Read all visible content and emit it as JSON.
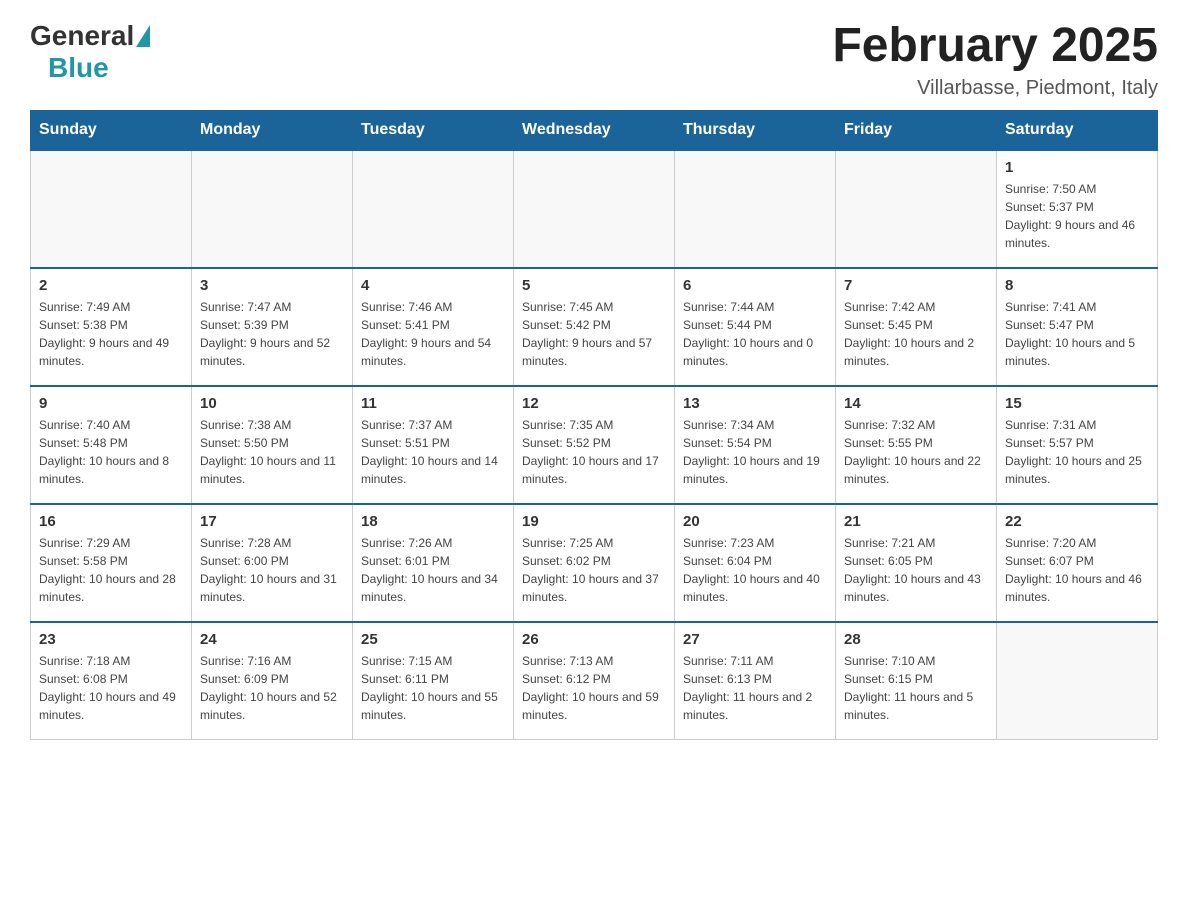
{
  "logo": {
    "general": "General",
    "blue": "Blue"
  },
  "title": "February 2025",
  "subtitle": "Villarbasse, Piedmont, Italy",
  "days_of_week": [
    "Sunday",
    "Monday",
    "Tuesday",
    "Wednesday",
    "Thursday",
    "Friday",
    "Saturday"
  ],
  "weeks": [
    {
      "days": [
        {
          "number": "",
          "info": "",
          "empty": true
        },
        {
          "number": "",
          "info": "",
          "empty": true
        },
        {
          "number": "",
          "info": "",
          "empty": true
        },
        {
          "number": "",
          "info": "",
          "empty": true
        },
        {
          "number": "",
          "info": "",
          "empty": true
        },
        {
          "number": "",
          "info": "",
          "empty": true
        },
        {
          "number": "1",
          "info": "Sunrise: 7:50 AM\nSunset: 5:37 PM\nDaylight: 9 hours and 46 minutes.",
          "empty": false
        }
      ]
    },
    {
      "days": [
        {
          "number": "2",
          "info": "Sunrise: 7:49 AM\nSunset: 5:38 PM\nDaylight: 9 hours and 49 minutes.",
          "empty": false
        },
        {
          "number": "3",
          "info": "Sunrise: 7:47 AM\nSunset: 5:39 PM\nDaylight: 9 hours and 52 minutes.",
          "empty": false
        },
        {
          "number": "4",
          "info": "Sunrise: 7:46 AM\nSunset: 5:41 PM\nDaylight: 9 hours and 54 minutes.",
          "empty": false
        },
        {
          "number": "5",
          "info": "Sunrise: 7:45 AM\nSunset: 5:42 PM\nDaylight: 9 hours and 57 minutes.",
          "empty": false
        },
        {
          "number": "6",
          "info": "Sunrise: 7:44 AM\nSunset: 5:44 PM\nDaylight: 10 hours and 0 minutes.",
          "empty": false
        },
        {
          "number": "7",
          "info": "Sunrise: 7:42 AM\nSunset: 5:45 PM\nDaylight: 10 hours and 2 minutes.",
          "empty": false
        },
        {
          "number": "8",
          "info": "Sunrise: 7:41 AM\nSunset: 5:47 PM\nDaylight: 10 hours and 5 minutes.",
          "empty": false
        }
      ]
    },
    {
      "days": [
        {
          "number": "9",
          "info": "Sunrise: 7:40 AM\nSunset: 5:48 PM\nDaylight: 10 hours and 8 minutes.",
          "empty": false
        },
        {
          "number": "10",
          "info": "Sunrise: 7:38 AM\nSunset: 5:50 PM\nDaylight: 10 hours and 11 minutes.",
          "empty": false
        },
        {
          "number": "11",
          "info": "Sunrise: 7:37 AM\nSunset: 5:51 PM\nDaylight: 10 hours and 14 minutes.",
          "empty": false
        },
        {
          "number": "12",
          "info": "Sunrise: 7:35 AM\nSunset: 5:52 PM\nDaylight: 10 hours and 17 minutes.",
          "empty": false
        },
        {
          "number": "13",
          "info": "Sunrise: 7:34 AM\nSunset: 5:54 PM\nDaylight: 10 hours and 19 minutes.",
          "empty": false
        },
        {
          "number": "14",
          "info": "Sunrise: 7:32 AM\nSunset: 5:55 PM\nDaylight: 10 hours and 22 minutes.",
          "empty": false
        },
        {
          "number": "15",
          "info": "Sunrise: 7:31 AM\nSunset: 5:57 PM\nDaylight: 10 hours and 25 minutes.",
          "empty": false
        }
      ]
    },
    {
      "days": [
        {
          "number": "16",
          "info": "Sunrise: 7:29 AM\nSunset: 5:58 PM\nDaylight: 10 hours and 28 minutes.",
          "empty": false
        },
        {
          "number": "17",
          "info": "Sunrise: 7:28 AM\nSunset: 6:00 PM\nDaylight: 10 hours and 31 minutes.",
          "empty": false
        },
        {
          "number": "18",
          "info": "Sunrise: 7:26 AM\nSunset: 6:01 PM\nDaylight: 10 hours and 34 minutes.",
          "empty": false
        },
        {
          "number": "19",
          "info": "Sunrise: 7:25 AM\nSunset: 6:02 PM\nDaylight: 10 hours and 37 minutes.",
          "empty": false
        },
        {
          "number": "20",
          "info": "Sunrise: 7:23 AM\nSunset: 6:04 PM\nDaylight: 10 hours and 40 minutes.",
          "empty": false
        },
        {
          "number": "21",
          "info": "Sunrise: 7:21 AM\nSunset: 6:05 PM\nDaylight: 10 hours and 43 minutes.",
          "empty": false
        },
        {
          "number": "22",
          "info": "Sunrise: 7:20 AM\nSunset: 6:07 PM\nDaylight: 10 hours and 46 minutes.",
          "empty": false
        }
      ]
    },
    {
      "days": [
        {
          "number": "23",
          "info": "Sunrise: 7:18 AM\nSunset: 6:08 PM\nDaylight: 10 hours and 49 minutes.",
          "empty": false
        },
        {
          "number": "24",
          "info": "Sunrise: 7:16 AM\nSunset: 6:09 PM\nDaylight: 10 hours and 52 minutes.",
          "empty": false
        },
        {
          "number": "25",
          "info": "Sunrise: 7:15 AM\nSunset: 6:11 PM\nDaylight: 10 hours and 55 minutes.",
          "empty": false
        },
        {
          "number": "26",
          "info": "Sunrise: 7:13 AM\nSunset: 6:12 PM\nDaylight: 10 hours and 59 minutes.",
          "empty": false
        },
        {
          "number": "27",
          "info": "Sunrise: 7:11 AM\nSunset: 6:13 PM\nDaylight: 11 hours and 2 minutes.",
          "empty": false
        },
        {
          "number": "28",
          "info": "Sunrise: 7:10 AM\nSunset: 6:15 PM\nDaylight: 11 hours and 5 minutes.",
          "empty": false
        },
        {
          "number": "",
          "info": "",
          "empty": true
        }
      ]
    }
  ]
}
